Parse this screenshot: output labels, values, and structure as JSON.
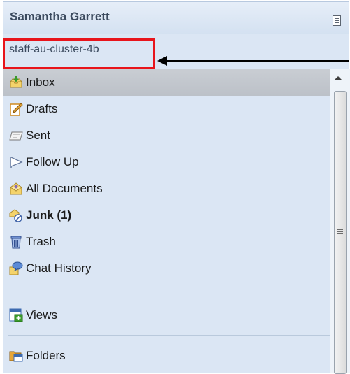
{
  "header": {
    "user_name": "Samantha Garrett"
  },
  "mailbox": {
    "name": "staff-au-cluster-4b"
  },
  "folders": [
    {
      "label": "Inbox",
      "icon": "inbox-icon",
      "selected": true,
      "bold": false
    },
    {
      "label": "Drafts",
      "icon": "drafts-icon",
      "selected": false,
      "bold": false
    },
    {
      "label": "Sent",
      "icon": "sent-icon",
      "selected": false,
      "bold": false
    },
    {
      "label": "Follow Up",
      "icon": "follow-up-flag-icon",
      "selected": false,
      "bold": false
    },
    {
      "label": "All Documents",
      "icon": "all-documents-icon",
      "selected": false,
      "bold": false
    },
    {
      "label": "Junk (1)",
      "icon": "junk-icon",
      "selected": false,
      "bold": true
    },
    {
      "label": "Trash",
      "icon": "trash-icon",
      "selected": false,
      "bold": false
    },
    {
      "label": "Chat History",
      "icon": "chat-history-icon",
      "selected": false,
      "bold": false
    }
  ],
  "views": {
    "label": "Views",
    "icon": "views-icon"
  },
  "folders_section": {
    "label": "Folders",
    "icon": "folders-icon"
  },
  "colors": {
    "panel_bg": "#dbe6f4",
    "highlight": "#e8141b",
    "selected_row": "#c3c8cf"
  }
}
